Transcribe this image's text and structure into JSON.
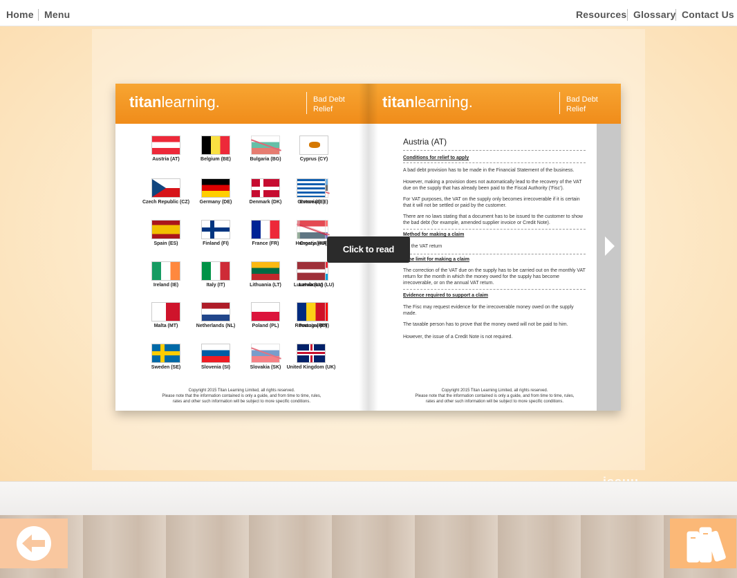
{
  "nav": {
    "home": "Home",
    "menu": "Menu",
    "resources": "Resources",
    "glossary": "Glossary",
    "contact": "Contact Us"
  },
  "brand": {
    "logo_bold": "titan",
    "logo_light": "learning.",
    "topic_line1": "Bad Debt",
    "topic_line2": "Relief"
  },
  "colors": {
    "header_orange": "#f28f1c",
    "back_button": "#f9c79f",
    "library_button": "#fbb877"
  },
  "flags": [
    {
      "label": "Austria (AT)"
    },
    {
      "label": "Belgium (BE)"
    },
    {
      "label": "Bulgaria (BG)"
    },
    {
      "label": "Cyprus (CY)"
    },
    {
      "label": "Czech Republic (CZ)"
    },
    {
      "label": "Germany (DE)"
    },
    {
      "label": "Denmark (DK)"
    },
    {
      "label": "Estonia (EE)"
    },
    {
      "label": "Greece (EL)"
    },
    {
      "label": "Spain (ES)"
    },
    {
      "label": "Finland (FI)"
    },
    {
      "label": "France (FR)"
    },
    {
      "label": "Croatia (HR)"
    },
    {
      "label": "Hungary (HU)"
    },
    {
      "label": "Ireland (IE)"
    },
    {
      "label": "Italy (IT)"
    },
    {
      "label": "Lithuania (LT)"
    },
    {
      "label": "Luxembourg (LU)"
    },
    {
      "label": "Latvia (LV)"
    },
    {
      "label": "Malta (MT)"
    },
    {
      "label": "Netherlands (NL)"
    },
    {
      "label": "Poland (PL)"
    },
    {
      "label": "Portugal (PT)"
    },
    {
      "label": "Romania (RO)"
    },
    {
      "label": "Sweden (SE)"
    },
    {
      "label": "Slovenia (SI)"
    },
    {
      "label": "Slovakia (SK)"
    },
    {
      "label": "United Kingdom (UK)"
    }
  ],
  "copyright": {
    "line1": "Copyright 2015 Titan Learning Limited, all rights reserved.",
    "line2": "Please note that the information contained is only a guide, and from time to time, rules,",
    "line3": "rates and other such information will be subject to more specific conditions."
  },
  "right_page": {
    "title": "Austria (AT)",
    "h1": "Conditions for relief to apply",
    "p1": "A bad debt provision has to be made in the Financial Statement of the business.",
    "p2": "However, making a provision does not automatically lead to the recovery of the VAT due on the supply that has already been paid to the Fiscal Authority ('Fisc').",
    "p3": "For VAT purposes, the VAT on the supply only becomes irrecoverable if it is certain that it will not be settled or paid by the customer.",
    "p4": "There are no laws stating that a document has to be issued to the customer to show the bad debt (for example, amended supplier invoice or Credit Note).",
    "h2": "Method for making a claim",
    "p5": "Via the VAT return",
    "h3": "Time limit for making a claim",
    "p6": "The correction of the VAT due on the supply has to be carried out on the monthly VAT return for the month in which the money owed for the supply has become irrecoverable, or on the annual VAT return.",
    "h4": "Evidence required to support a claim",
    "p7": "The Fisc may request evidence for the irrecoverable money owed on the supply made.",
    "p8": "The taxable person has to prove that the money owed will not be paid to him.",
    "p9": "However, the issue of a Credit Note is not required."
  },
  "overlay": {
    "click_to_read": "Click to read",
    "issuu": "issuu"
  }
}
